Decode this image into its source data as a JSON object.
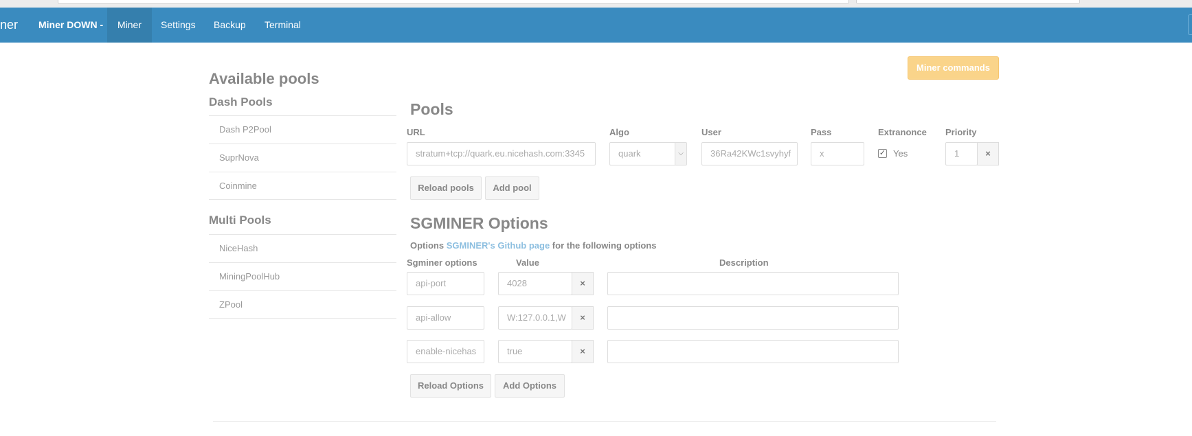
{
  "navbar": {
    "brand": "ner",
    "status": "Miner DOWN -",
    "links": [
      "Miner",
      "Settings",
      "Backup",
      "Terminal"
    ]
  },
  "sidebar": {
    "title": "Available pools",
    "dash_title": "Dash Pools",
    "dash_pools": [
      "Dash P2Pool",
      "SuprNova",
      "Coinmine"
    ],
    "multi_title": "Multi Pools",
    "multi_pools": [
      "NiceHash",
      "MiningPoolHub",
      "ZPool"
    ]
  },
  "actions": {
    "miner_commands": "Miner commands"
  },
  "pools": {
    "title": "Pools",
    "headers": {
      "url": "URL",
      "algo": "Algo",
      "user": "User",
      "pass": "Pass",
      "extranonce": "Extranonce",
      "priority": "Priority"
    },
    "row": {
      "url": "stratum+tcp://quark.eu.nicehash.com:3345",
      "algo": "quark",
      "user": "36Ra42KWc1svyhyf",
      "pass": "x",
      "extranonce_label": "Yes",
      "priority": "1",
      "remove": "×"
    },
    "reload_label": "Reload pools",
    "add_label": "Add pool"
  },
  "sgminer": {
    "title": "SGMINER Options",
    "note_prefix": "Options",
    "note_link": "SGMINER's Github page",
    "note_suffix": "for the following options",
    "headers": {
      "option": "Sgminer options",
      "value": "Value",
      "description": "Description"
    },
    "rows": [
      {
        "option": "api-port",
        "value": "4028",
        "remove": "×",
        "description": ""
      },
      {
        "option": "api-allow",
        "value": "W:127.0.0.1,W",
        "remove": "×",
        "description": ""
      },
      {
        "option": "enable-nicehas",
        "value": "true",
        "remove": "×",
        "description": ""
      }
    ],
    "reload_label": "Reload Options",
    "add_label": "Add Options"
  }
}
